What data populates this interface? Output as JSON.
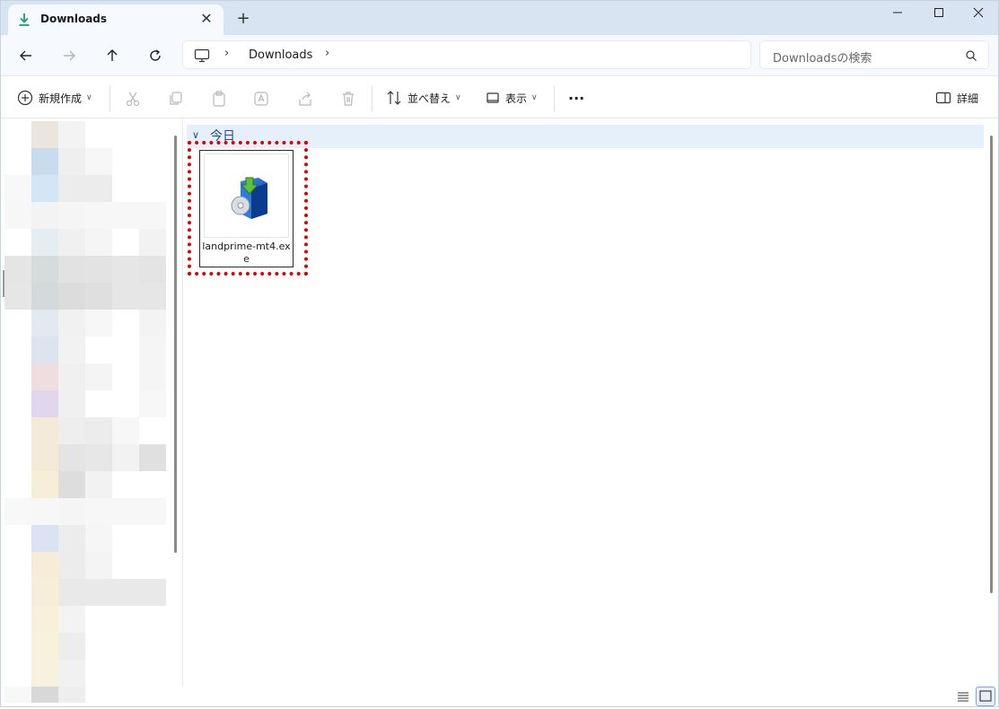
{
  "tab": {
    "title": "Downloads",
    "close": "✕",
    "new": "+"
  },
  "window_controls": {
    "minimize": "—",
    "maximize": "☐",
    "close": "✕"
  },
  "address": {
    "separator": "›",
    "crumb": "Downloads",
    "trailing_separator": "›"
  },
  "search": {
    "placeholder": "Downloadsの検索"
  },
  "toolbar": {
    "new_label": "新規作成",
    "sort_label": "並べ替え",
    "view_label": "表示",
    "more_label": "···",
    "details_label": "詳細"
  },
  "content": {
    "group_label": "今日",
    "group_chevron": "∨",
    "file": {
      "name": "landprime-mt4.exe",
      "icon": "installer-box-icon"
    }
  },
  "colors": {
    "accent": "#1f4e8c",
    "highlight": "#e30000",
    "tab_bg": "#d9e4f2",
    "group_bg": "#e5f0fb"
  }
}
